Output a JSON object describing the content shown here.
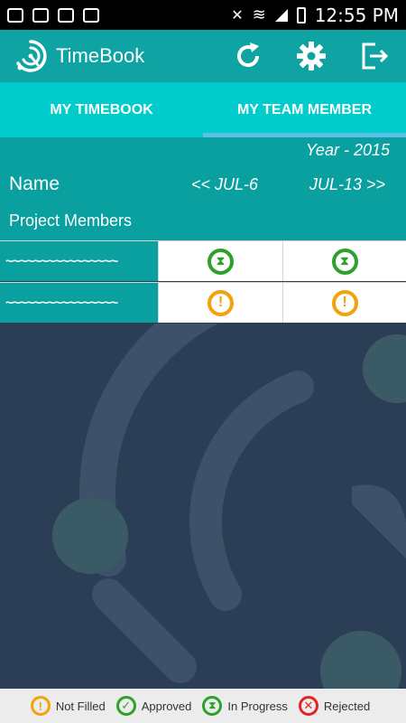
{
  "app": {
    "title": "TimeBook"
  },
  "status_bar": {
    "time": "12:55 PM"
  },
  "tabs": [
    {
      "label": "MY TIMEBOOK",
      "active": false
    },
    {
      "label": "MY TEAM MEMBER",
      "active": true
    }
  ],
  "header": {
    "year": "Year - 2015",
    "name_label": "Name",
    "prev_week": "<<  JUL-6",
    "next_week": "JUL-13  >>",
    "project_members_label": "Project Members"
  },
  "rows": [
    {
      "name": "~~~~~~~~~~~~~~~~",
      "statuses": [
        "in-progress",
        "in-progress"
      ]
    },
    {
      "name": "~~~~~~~~~~~~~~~~",
      "statuses": [
        "not-filled",
        "not-filled"
      ]
    }
  ],
  "legend": [
    {
      "label": "Not Filled",
      "icon": "not-filled-icon",
      "color": "#f2a20c"
    },
    {
      "label": "Approved",
      "icon": "approved-icon",
      "color": "#2ca12c"
    },
    {
      "label": "In Progress",
      "icon": "in-progress-icon",
      "color": "#2ca12c"
    },
    {
      "label": "Rejected",
      "icon": "rejected-icon",
      "color": "#e42424"
    }
  ],
  "colors": {
    "teal_dark": "#0aa09f",
    "teal_light": "#00cccc",
    "background": "#2c3e55"
  }
}
